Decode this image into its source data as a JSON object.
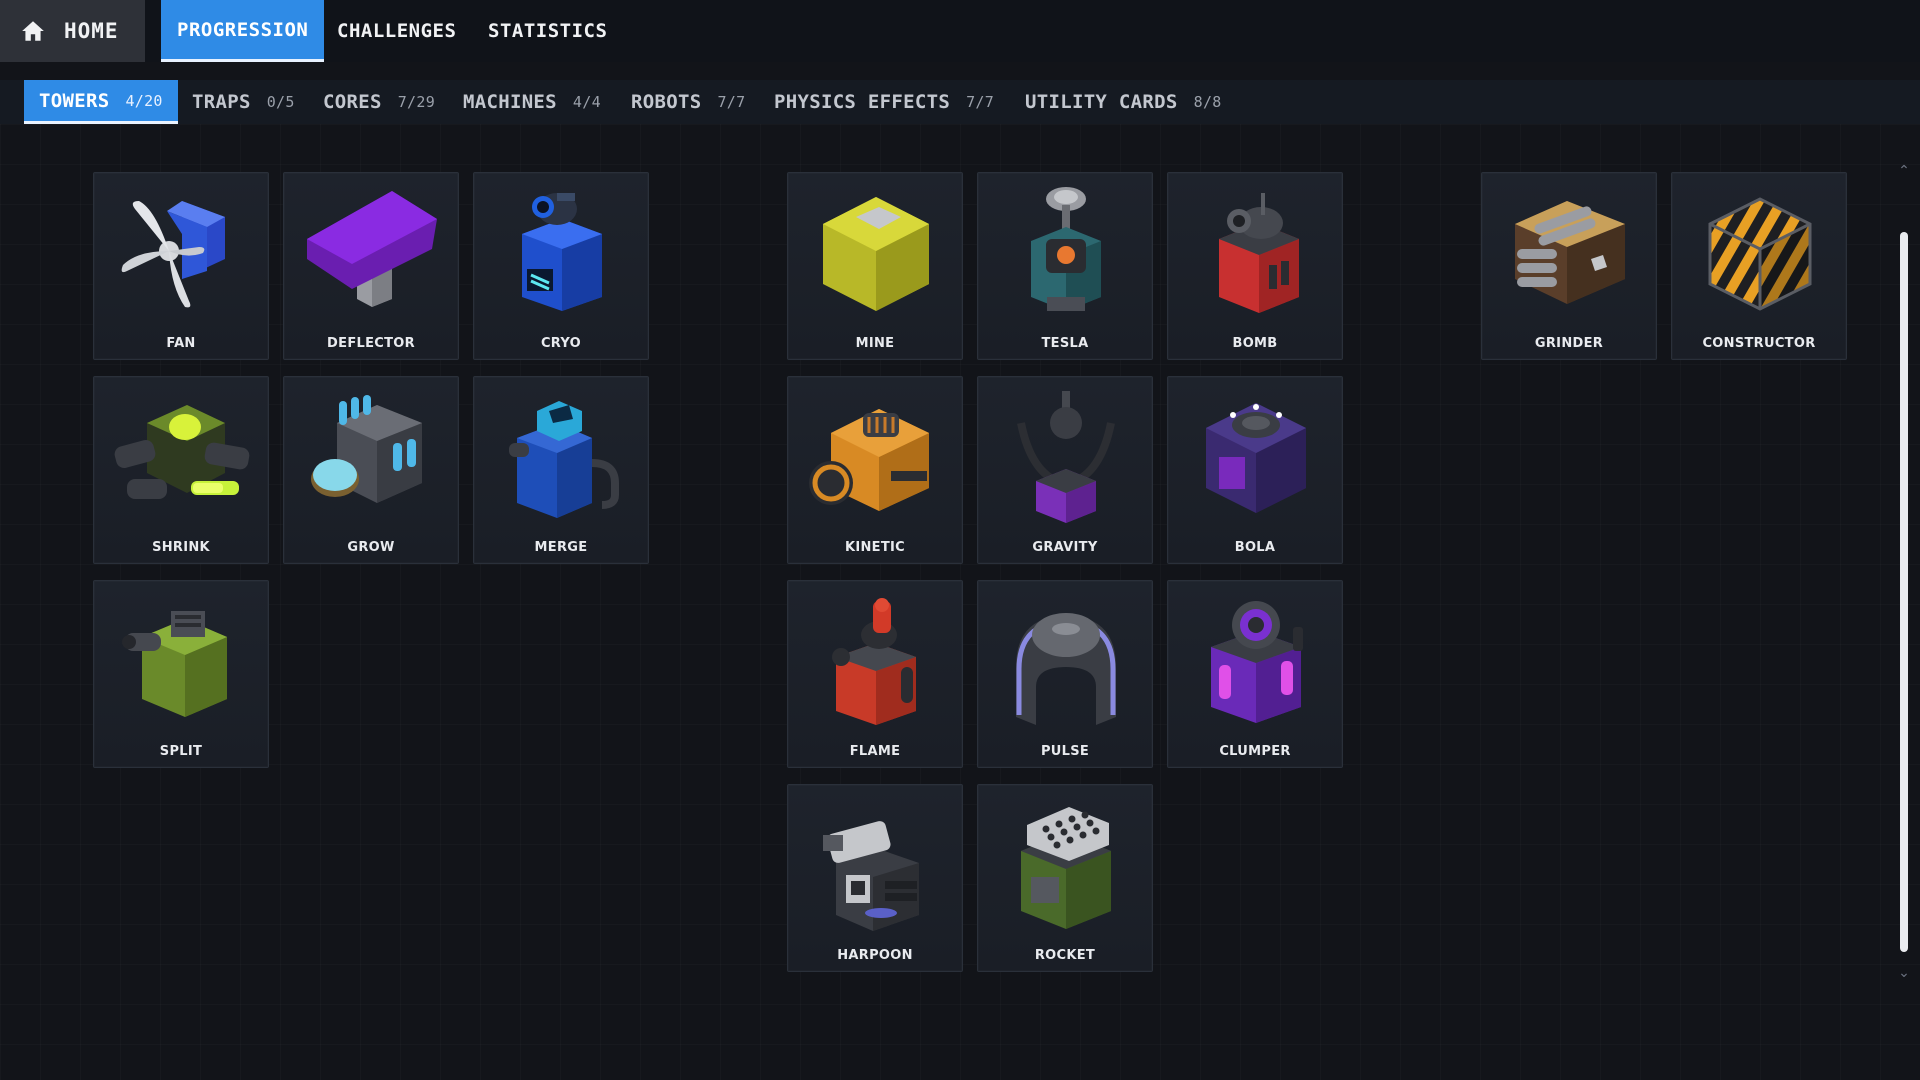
{
  "nav": {
    "home_label": "HOME",
    "tabs": [
      {
        "label": "PROGRESSION",
        "active": true
      },
      {
        "label": "CHALLENGES",
        "active": false
      },
      {
        "label": "STATISTICS",
        "active": false
      }
    ]
  },
  "categories": [
    {
      "label": "TOWERS",
      "count": "4/20",
      "active": true
    },
    {
      "label": "TRAPS",
      "count": "0/5",
      "active": false
    },
    {
      "label": "CORES",
      "count": "7/29",
      "active": false
    },
    {
      "label": "MACHINES",
      "count": "4/4",
      "active": false
    },
    {
      "label": "ROBOTS",
      "count": "7/7",
      "active": false
    },
    {
      "label": "PHYSICS EFFECTS",
      "count": "7/7",
      "active": false
    },
    {
      "label": "UTILITY CARDS",
      "count": "8/8",
      "active": false
    }
  ],
  "towers": [
    {
      "label": "FAN",
      "icon": "fan-icon"
    },
    {
      "label": "DEFLECTOR",
      "icon": "deflector-icon"
    },
    {
      "label": "CRYO",
      "icon": "cryo-icon"
    },
    {
      "label": "SHRINK",
      "icon": "shrink-icon"
    },
    {
      "label": "GROW",
      "icon": "grow-icon"
    },
    {
      "label": "MERGE",
      "icon": "merge-icon"
    },
    {
      "label": "SPLIT",
      "icon": "split-icon"
    },
    {
      "label": "MINE",
      "icon": "mine-icon"
    },
    {
      "label": "TESLA",
      "icon": "tesla-icon"
    },
    {
      "label": "BOMB",
      "icon": "bomb-icon"
    },
    {
      "label": "KINETIC",
      "icon": "kinetic-icon"
    },
    {
      "label": "GRAVITY",
      "icon": "gravity-icon"
    },
    {
      "label": "BOLA",
      "icon": "bola-icon"
    },
    {
      "label": "FLAME",
      "icon": "flame-icon"
    },
    {
      "label": "PULSE",
      "icon": "pulse-icon"
    },
    {
      "label": "CLUMPER",
      "icon": "clumper-icon"
    },
    {
      "label": "HARPOON",
      "icon": "harpoon-icon"
    },
    {
      "label": "ROCKET",
      "icon": "rocket-icon"
    },
    {
      "label": "GRINDER",
      "icon": "grinder-icon"
    },
    {
      "label": "CONSTRUCTOR",
      "icon": "constructor-icon"
    }
  ],
  "colors": {
    "accent": "#2f8be6",
    "background": "#121419",
    "card": "#1d222b"
  }
}
